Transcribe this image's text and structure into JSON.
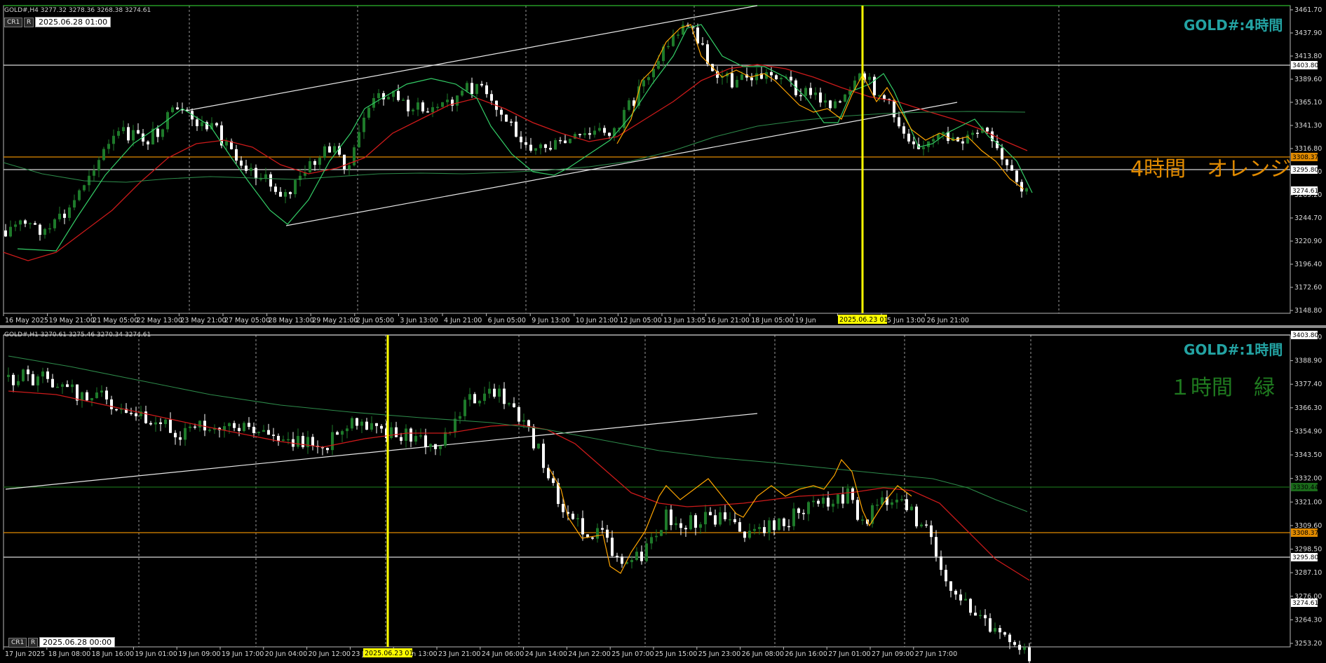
{
  "h4": {
    "header": "GOLD#,H4  3277.32 3278.36 3268.38 3274.61",
    "title": "GOLD#:4時間",
    "note": "4時間　オレンジ",
    "date_box": "2025.06.28 01:00",
    "buttons": [
      "CR1",
      "R"
    ],
    "y_labels": [
      "3461.70",
      "3437.90",
      "3413.80",
      "3389.60",
      "3365.10",
      "3341.30",
      "3316.80",
      "3292.70",
      "3269.20",
      "3244.70",
      "3220.90",
      "3196.40",
      "3172.60",
      "3148.80"
    ],
    "x_labels": [
      "16 May 2025",
      "19 May 21:00",
      "21 May 05:00",
      "22 May 13:00",
      "23 May 21:00",
      "27 May 05:00",
      "28 May 13:00",
      "29 May 21:00",
      "2 Jun 05:00",
      "3 Jun 13:00",
      "4 Jun 21:00",
      "6 Jun 05:00",
      "9 Jun 13:00",
      "10 Jun 21:00",
      "12 Jun 05:00",
      "13 Jun 13:05",
      "16 Jun 21:00",
      "18 Jun 05:00",
      "19 Jun",
      "24 Jun 05:00",
      "25 Jun 13:00",
      "26 Jun 21:00"
    ],
    "cursor_label": "2025.06.23 01:00",
    "price_tags": {
      "white_upper": "3403.80",
      "orange": "3308.37",
      "white_lower": "3295.80",
      "current": "3274.61"
    }
  },
  "h1": {
    "header": "GOLD#,H1  3270.61 3275.46 3270.34 3274.61",
    "title": "GOLD#:1時間",
    "note": "１時間　緑",
    "date_box": "2025.06.28 00:00",
    "buttons": [
      "CR1",
      "R"
    ],
    "y_labels": [
      "3400.20",
      "3388.90",
      "3377.40",
      "3366.30",
      "3354.90",
      "3343.50",
      "3332.00",
      "3321.00",
      "3309.60",
      "3298.50",
      "3287.10",
      "3276.00",
      "3264.30",
      "3253.20"
    ],
    "x_labels": [
      "17 Jun 2025",
      "18 Jun 08:00",
      "18 Jun 16:00",
      "19 Jun 01:00",
      "19 Jun 09:00",
      "19 Jun 17:00",
      "20 Jun 04:00",
      "20 Jun 12:00",
      "23 Jun 05:00",
      "23 Jun 13:00",
      "23 Jun 21:00",
      "24 Jun 06:00",
      "24 Jun 14:00",
      "24 Jun 22:00",
      "25 Jun 07:00",
      "25 Jun 15:00",
      "25 Jun 23:00",
      "26 Jun 08:00",
      "26 Jun 16:00",
      "27 Jun 01:00",
      "27 Jun 09:00",
      "27 Jun 17:00"
    ],
    "cursor_label": "2025.06.23 01:00",
    "price_tags": {
      "white_upper": "3403.80",
      "green": "3330.44",
      "orange": "3308.37",
      "white_lower": "3295.80",
      "current": "3274.61"
    }
  },
  "colors": {
    "bull": "#1e7a2a",
    "bear": "#ffffff",
    "red_ma": "#cc1a1a",
    "green_ma": "#2d8a4a",
    "zigzag_green": "#33cc66",
    "zigzag_orange": "#ffa500",
    "cursor": "#ffff00",
    "orange_line": "#e08a00",
    "title": "#23a3a3",
    "note_green": "#1f7a1f"
  }
}
